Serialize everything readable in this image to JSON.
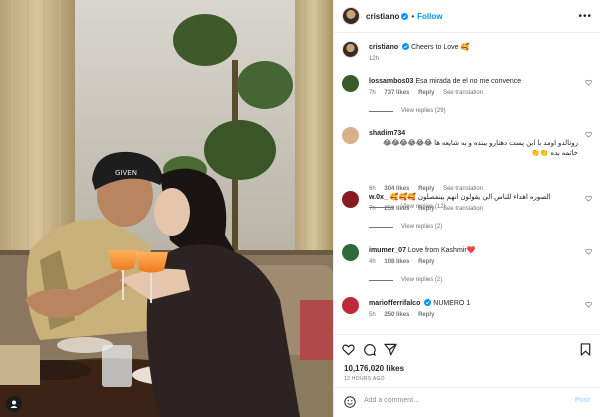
{
  "header": {
    "username": "cristiano",
    "separator": "•",
    "follow_label": "Follow",
    "more_label": "•••"
  },
  "caption": {
    "username": "cristiano",
    "text": "Cheers to Love 🥰",
    "time": "12h"
  },
  "comments": [
    {
      "username": "lossambos03",
      "text": "Esa mirada de el no me convence",
      "time": "7h",
      "likes": "737 likes",
      "reply_label": "Reply",
      "translation_label": "See translation",
      "view_replies": "View replies (29)",
      "avatar_color": "#3a5a2a"
    },
    {
      "username": "shadim734",
      "text": "رونالدو اومد با ابن پست دهنارو ببنده و به شایعه ها 😂😂😂😂😂😂 خاتمه بده 👏👏",
      "time": "6h",
      "likes": "304 likes",
      "reply_label": "Reply",
      "translation_label": "See translation",
      "view_replies": "View replies (12)",
      "avatar_color": "#d8b08a"
    },
    {
      "username": "w.0x_",
      "text": "الصوره اهداء للناس الي يقولون انهم بينفصلون 🥰🥰🥰",
      "time": "7h",
      "likes": "259 likes",
      "reply_label": "Reply",
      "translation_label": "See translation",
      "view_replies": "View replies (2)",
      "avatar_color": "#8a1a22"
    },
    {
      "username": "imumer_07",
      "text": "Love from Kashmir❤️",
      "time": "4h",
      "likes": "108 likes",
      "reply_label": "Reply",
      "translation_label": "",
      "view_replies": "View replies (2)",
      "avatar_color": "#2f6b3a"
    },
    {
      "username": "mariofferrifalco",
      "text": "NUMERO 1",
      "time": "5h",
      "likes": "250 likes",
      "reply_label": "Reply",
      "translation_label": "",
      "view_replies": "",
      "avatar_color": "#c0293a"
    }
  ],
  "footer": {
    "likes": "10,176,020 likes",
    "time_ago": "12 HOURS AGO",
    "add_comment_placeholder": "Add a comment…",
    "post_label": "Post"
  },
  "icons": [
    "more-icon",
    "verified-icon",
    "heart-icon",
    "comment-icon",
    "share-icon",
    "bookmark-icon",
    "emoji-icon"
  ],
  "colors": {
    "accent": "#0095f6",
    "verified": "#0095f6",
    "secondary_text": "#737373",
    "border": "#efefef"
  }
}
